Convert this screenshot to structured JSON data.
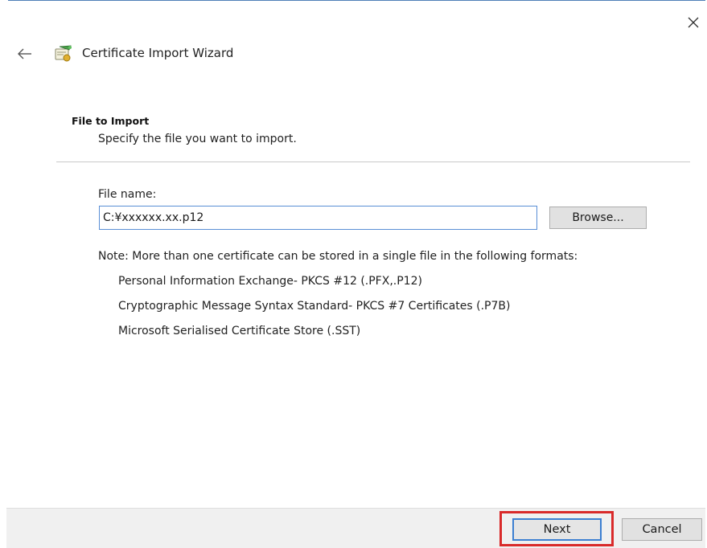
{
  "window": {
    "title": "Certificate Import Wizard",
    "title_icon": "certificate-wizard-icon",
    "close_icon": "close-icon",
    "back_icon": "back-arrow-icon",
    "border_color": "#4f7fb8"
  },
  "page": {
    "heading": "File to Import",
    "description": "Specify the file you want to import."
  },
  "file_field": {
    "label": "File name:",
    "value": "C:¥xxxxxx.xx.p12",
    "browse_label": "Browse..."
  },
  "note": {
    "text": "Note:  More than one certificate can be stored in a single file in the following formats:",
    "formats": [
      "Personal Information Exchange- PKCS #12 (.PFX,.P12)",
      "Cryptographic Message Syntax Standard- PKCS #7 Certificates (.P7B)",
      "Microsoft Serialised Certificate Store (.SST)"
    ]
  },
  "footer": {
    "next_label": "Next",
    "cancel_label": "Cancel",
    "highlight_color": "#d92a2a",
    "focus_color": "#3c7fd1"
  }
}
